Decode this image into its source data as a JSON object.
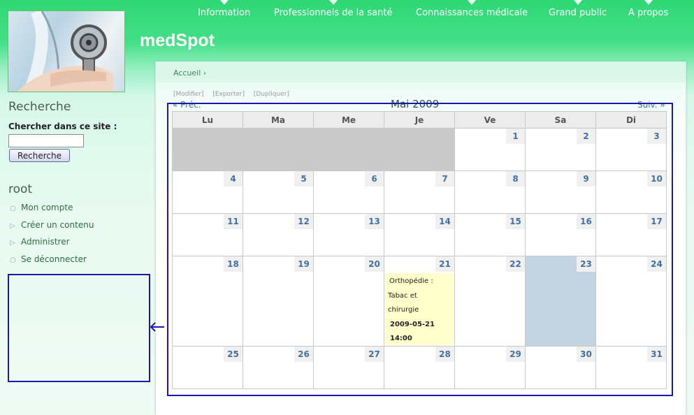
{
  "nav": {
    "items": [
      "Information",
      "Professionnels de la santé",
      "Connaissances médicale",
      "Grand public",
      "A propos"
    ]
  },
  "site": {
    "title": "medSpot"
  },
  "breadcrumb": {
    "home": "Accueil ›"
  },
  "actions": {
    "edit": "[Modifier]",
    "export": "[Exporter]",
    "duplicate": "[Dupliquer]"
  },
  "calendar": {
    "prev": "« Préc.",
    "next": "Suiv. »",
    "month": "Mai 2009",
    "weekdays": [
      "Lu",
      "Ma",
      "Me",
      "Je",
      "Ve",
      "Sa",
      "Di"
    ],
    "days": [
      "1",
      "2",
      "3",
      "4",
      "5",
      "6",
      "7",
      "8",
      "9",
      "10",
      "11",
      "12",
      "13",
      "14",
      "15",
      "16",
      "17",
      "18",
      "19",
      "20",
      "21",
      "22",
      "23",
      "24",
      "25",
      "26",
      "27",
      "28",
      "29",
      "30",
      "31"
    ],
    "event": {
      "title_line1": "Orthopédie :",
      "title_line2": "Tabac et",
      "title_line3": "chirurgie",
      "date": "2009-05-21",
      "time": "14:00"
    }
  },
  "sidebar": {
    "search_title": "Recherche",
    "search_label": "Chercher dans ce site :",
    "search_value": "",
    "search_button": "Recherche",
    "user_title": "root",
    "menu": [
      "Mon compte",
      "Créer un contenu",
      "Administrer",
      "Se déconnecter"
    ]
  },
  "colors": {
    "header_green": "#2fd774",
    "link_blue": "#4170a4",
    "focus_outline": "#1a1aa8"
  }
}
